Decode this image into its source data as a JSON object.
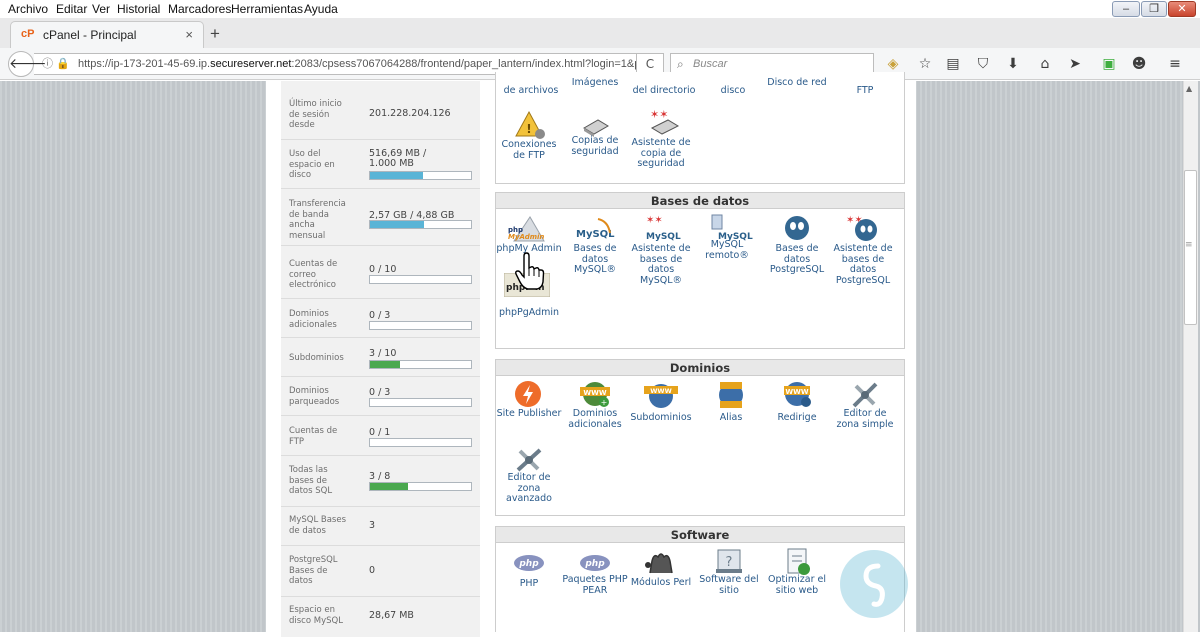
{
  "menubar": {
    "archivo": "Archivo",
    "editar": "Editar",
    "ver": "Ver",
    "historial": "Historial",
    "marcadores": "Marcadores",
    "herramientas": "Herramientas",
    "ayuda": "Ayuda"
  },
  "window_controls": {
    "min": "–",
    "max": "❐",
    "close": "✕"
  },
  "tab": {
    "title": "cPanel - Principal",
    "close": "×",
    "new": "+"
  },
  "nav": {
    "url_prefix": "https://ip-173-201-45-69.ip.",
    "url_domain": "secureserver.net",
    "url_rest": ":2083/cpsess7067064288/frontend/paper_lantern/index.html?login=1&p",
    "search_placeholder": "Buscar",
    "reload": "C"
  },
  "stats": [
    {
      "label": "Último inicio de sesión desde",
      "value": "201.228.204.126"
    },
    {
      "label": "Uso del espacio en disco",
      "value": "516,69 MB / 1.000 MB",
      "progress": 0.52
    },
    {
      "label": "Transferencia de banda ancha mensual",
      "value": "2,57 GB / 4,88 GB",
      "progress": 0.53
    },
    {
      "label": "Cuentas de correo electrónico",
      "value": "0 / 10",
      "progress": 0
    },
    {
      "label": "Dominios adicionales",
      "value": "0 / 3",
      "progress": 0
    },
    {
      "label": "Subdominios",
      "value": "3 / 10",
      "progress": 0.3
    },
    {
      "label": "Dominios parqueados",
      "value": "0 / 3",
      "progress": 0
    },
    {
      "label": "Cuentas de FTP",
      "value": "0 / 1",
      "progress": 0
    },
    {
      "label": "Todas las bases de datos SQL",
      "value": "3 / 8",
      "progress": 0.38
    },
    {
      "label": "MySQL Bases de datos",
      "value": "3"
    },
    {
      "label": "PostgreSQL Bases de datos",
      "value": "0"
    },
    {
      "label": "Espacio en disco MySQL",
      "value": "28,67 MB"
    }
  ],
  "top_labels": {
    "archivos": "de archivos",
    "imagenes": "Imágenes",
    "directorio": "del directorio",
    "disco": "disco",
    "disco_red": "Disco de red",
    "ftp": "FTP"
  },
  "archivos": {
    "conexiones_ftp": "Conexiones de FTP",
    "copias": "Copias de seguridad",
    "asistente_copia": "Asistente de copia de seguridad"
  },
  "bases_de_datos": {
    "title": "Bases de datos",
    "phpmyadmin": "phpMy Admin",
    "mysql": "Bases de datos MySQL®",
    "asistente_mysql": "Asistente de bases de datos MySQL®",
    "mysql_remoto": "MySQL remoto®",
    "postgresql": "Bases de datos PostgreSQL",
    "asistente_postgresql": "Asistente de bases de datos PostgreSQL",
    "phppgadmin": "phpPgAdmin",
    "mysql_logo": "MySQL",
    "php_logo": "php",
    "myadmin_logo": "MyAdmin",
    "phppga_logo": "phpP in"
  },
  "dominios": {
    "title": "Dominios",
    "site_publisher": "Site Publisher",
    "dominios_adicionales": "Dominios adicionales",
    "subdominios": "Subdominios",
    "alias": "Alias",
    "redirige": "Redirige",
    "editor_simple": "Editor de zona simple",
    "editor_avanzado": "Editor de zona avanzado",
    "www": "WWW"
  },
  "software": {
    "title": "Software",
    "php": "PHP",
    "pear": "Paquetes PHP PEAR",
    "perl": "Módulos Perl",
    "softaculous": "Software del sitio",
    "optimizar": "Optimizar el sitio web",
    "php_logo": "php"
  },
  "colors": {
    "bar_blue": "#5ab4d6",
    "bar_green": "#4aa84f",
    "link": "#2a5a8a",
    "header_bg": "#e8e8e8"
  }
}
